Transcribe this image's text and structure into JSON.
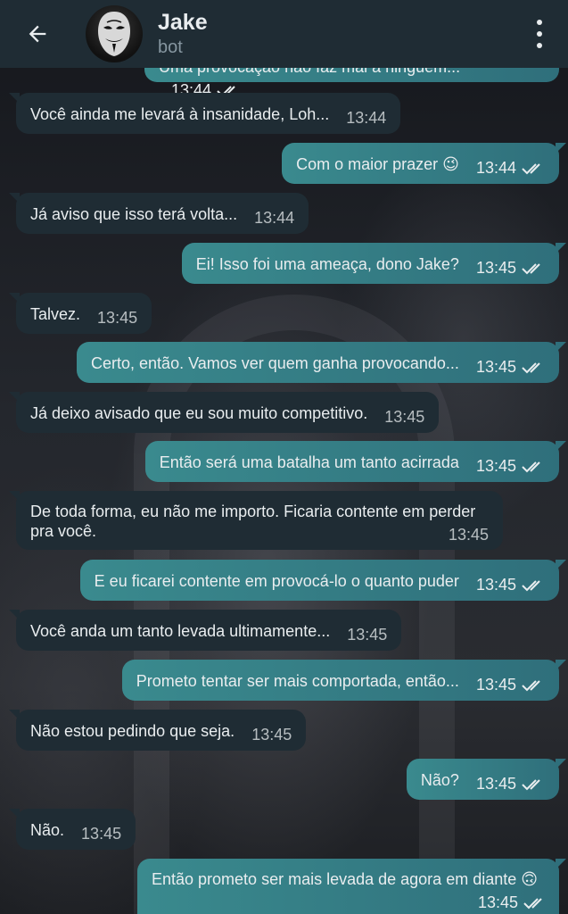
{
  "header": {
    "name": "Jake",
    "status": "bot",
    "back_icon": "arrow-left-icon",
    "menu_icon": "more-vertical-icon",
    "avatar_icon": "mask-avatar"
  },
  "colors": {
    "header_bg": "#1f2c34",
    "incoming_bubble": "#1f2c34",
    "outgoing_bubble": "#2f6f7b",
    "text": "#e9edef",
    "secondary_text": "#8696a0"
  },
  "messages": [
    {
      "dir": "out",
      "text": "Uma provocação não faz mal a ninguém...",
      "time": "13:44",
      "read": true
    },
    {
      "dir": "in",
      "text": "Você ainda me levará à insanidade, Loh...",
      "time": "13:44"
    },
    {
      "dir": "out",
      "text": "Com o maior prazer 😉",
      "time": "13:44",
      "read": true
    },
    {
      "dir": "in",
      "text": "Já aviso que isso terá volta...",
      "time": "13:44"
    },
    {
      "dir": "out",
      "text": "Ei! Isso foi uma ameaça, dono Jake?",
      "time": "13:45",
      "read": true
    },
    {
      "dir": "in",
      "text": "Talvez.",
      "time": "13:45"
    },
    {
      "dir": "out",
      "text": "Certo, então. Vamos ver quem ganha provocando...",
      "time": "13:45",
      "read": true
    },
    {
      "dir": "in",
      "text": "Já deixo avisado que eu sou muito competitivo.",
      "time": "13:45"
    },
    {
      "dir": "out",
      "text": "Então será uma batalha um tanto acirrada",
      "time": "13:45",
      "read": true
    },
    {
      "dir": "in",
      "text": "De toda forma, eu não me importo. Ficaria contente em perder pra você.",
      "time": "13:45"
    },
    {
      "dir": "out",
      "text": "E eu ficarei contente em provocá-lo o quanto puder",
      "time": "13:45",
      "read": true
    },
    {
      "dir": "in",
      "text": "Você anda um tanto levada ultimamente...",
      "time": "13:45"
    },
    {
      "dir": "out",
      "text": "Prometo tentar ser mais comportada, então...",
      "time": "13:45",
      "read": true
    },
    {
      "dir": "in",
      "text": "Não estou pedindo que seja.",
      "time": "13:45"
    },
    {
      "dir": "out",
      "text": "Não?",
      "time": "13:45",
      "read": true
    },
    {
      "dir": "in",
      "text": "Não.",
      "time": "13:45"
    },
    {
      "dir": "out",
      "text": "Então prometo ser mais levada de agora em diante 🙃",
      "time": "13:45",
      "read": true
    }
  ]
}
